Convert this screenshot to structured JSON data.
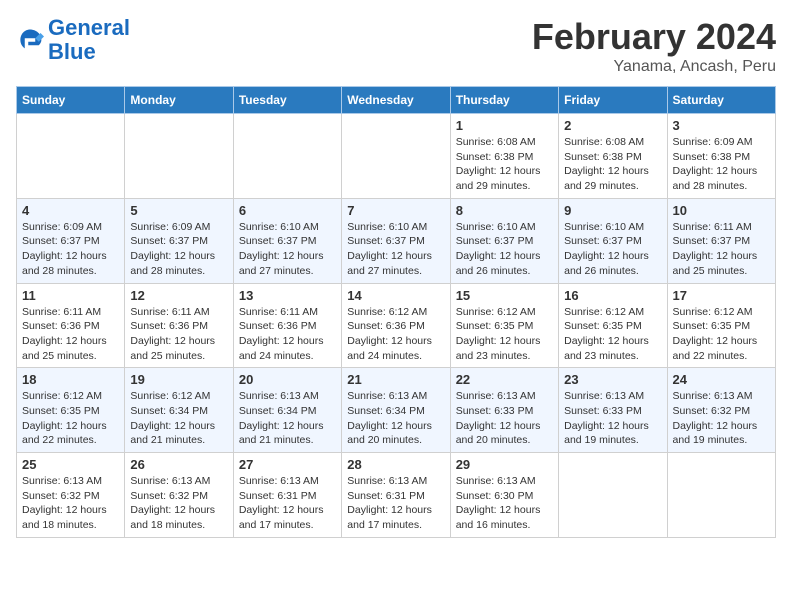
{
  "header": {
    "logo_line1": "General",
    "logo_line2": "Blue",
    "main_title": "February 2024",
    "sub_title": "Yanama, Ancash, Peru"
  },
  "weekdays": [
    "Sunday",
    "Monday",
    "Tuesday",
    "Wednesday",
    "Thursday",
    "Friday",
    "Saturday"
  ],
  "weeks": [
    [
      {
        "day": "",
        "info": ""
      },
      {
        "day": "",
        "info": ""
      },
      {
        "day": "",
        "info": ""
      },
      {
        "day": "",
        "info": ""
      },
      {
        "day": "1",
        "info": "Sunrise: 6:08 AM\nSunset: 6:38 PM\nDaylight: 12 hours and 29 minutes."
      },
      {
        "day": "2",
        "info": "Sunrise: 6:08 AM\nSunset: 6:38 PM\nDaylight: 12 hours and 29 minutes."
      },
      {
        "day": "3",
        "info": "Sunrise: 6:09 AM\nSunset: 6:38 PM\nDaylight: 12 hours and 28 minutes."
      }
    ],
    [
      {
        "day": "4",
        "info": "Sunrise: 6:09 AM\nSunset: 6:37 PM\nDaylight: 12 hours and 28 minutes."
      },
      {
        "day": "5",
        "info": "Sunrise: 6:09 AM\nSunset: 6:37 PM\nDaylight: 12 hours and 28 minutes."
      },
      {
        "day": "6",
        "info": "Sunrise: 6:10 AM\nSunset: 6:37 PM\nDaylight: 12 hours and 27 minutes."
      },
      {
        "day": "7",
        "info": "Sunrise: 6:10 AM\nSunset: 6:37 PM\nDaylight: 12 hours and 27 minutes."
      },
      {
        "day": "8",
        "info": "Sunrise: 6:10 AM\nSunset: 6:37 PM\nDaylight: 12 hours and 26 minutes."
      },
      {
        "day": "9",
        "info": "Sunrise: 6:10 AM\nSunset: 6:37 PM\nDaylight: 12 hours and 26 minutes."
      },
      {
        "day": "10",
        "info": "Sunrise: 6:11 AM\nSunset: 6:37 PM\nDaylight: 12 hours and 25 minutes."
      }
    ],
    [
      {
        "day": "11",
        "info": "Sunrise: 6:11 AM\nSunset: 6:36 PM\nDaylight: 12 hours and 25 minutes."
      },
      {
        "day": "12",
        "info": "Sunrise: 6:11 AM\nSunset: 6:36 PM\nDaylight: 12 hours and 25 minutes."
      },
      {
        "day": "13",
        "info": "Sunrise: 6:11 AM\nSunset: 6:36 PM\nDaylight: 12 hours and 24 minutes."
      },
      {
        "day": "14",
        "info": "Sunrise: 6:12 AM\nSunset: 6:36 PM\nDaylight: 12 hours and 24 minutes."
      },
      {
        "day": "15",
        "info": "Sunrise: 6:12 AM\nSunset: 6:35 PM\nDaylight: 12 hours and 23 minutes."
      },
      {
        "day": "16",
        "info": "Sunrise: 6:12 AM\nSunset: 6:35 PM\nDaylight: 12 hours and 23 minutes."
      },
      {
        "day": "17",
        "info": "Sunrise: 6:12 AM\nSunset: 6:35 PM\nDaylight: 12 hours and 22 minutes."
      }
    ],
    [
      {
        "day": "18",
        "info": "Sunrise: 6:12 AM\nSunset: 6:35 PM\nDaylight: 12 hours and 22 minutes."
      },
      {
        "day": "19",
        "info": "Sunrise: 6:12 AM\nSunset: 6:34 PM\nDaylight: 12 hours and 21 minutes."
      },
      {
        "day": "20",
        "info": "Sunrise: 6:13 AM\nSunset: 6:34 PM\nDaylight: 12 hours and 21 minutes."
      },
      {
        "day": "21",
        "info": "Sunrise: 6:13 AM\nSunset: 6:34 PM\nDaylight: 12 hours and 20 minutes."
      },
      {
        "day": "22",
        "info": "Sunrise: 6:13 AM\nSunset: 6:33 PM\nDaylight: 12 hours and 20 minutes."
      },
      {
        "day": "23",
        "info": "Sunrise: 6:13 AM\nSunset: 6:33 PM\nDaylight: 12 hours and 19 minutes."
      },
      {
        "day": "24",
        "info": "Sunrise: 6:13 AM\nSunset: 6:32 PM\nDaylight: 12 hours and 19 minutes."
      }
    ],
    [
      {
        "day": "25",
        "info": "Sunrise: 6:13 AM\nSunset: 6:32 PM\nDaylight: 12 hours and 18 minutes."
      },
      {
        "day": "26",
        "info": "Sunrise: 6:13 AM\nSunset: 6:32 PM\nDaylight: 12 hours and 18 minutes."
      },
      {
        "day": "27",
        "info": "Sunrise: 6:13 AM\nSunset: 6:31 PM\nDaylight: 12 hours and 17 minutes."
      },
      {
        "day": "28",
        "info": "Sunrise: 6:13 AM\nSunset: 6:31 PM\nDaylight: 12 hours and 17 minutes."
      },
      {
        "day": "29",
        "info": "Sunrise: 6:13 AM\nSunset: 6:30 PM\nDaylight: 12 hours and 16 minutes."
      },
      {
        "day": "",
        "info": ""
      },
      {
        "day": "",
        "info": ""
      }
    ]
  ]
}
